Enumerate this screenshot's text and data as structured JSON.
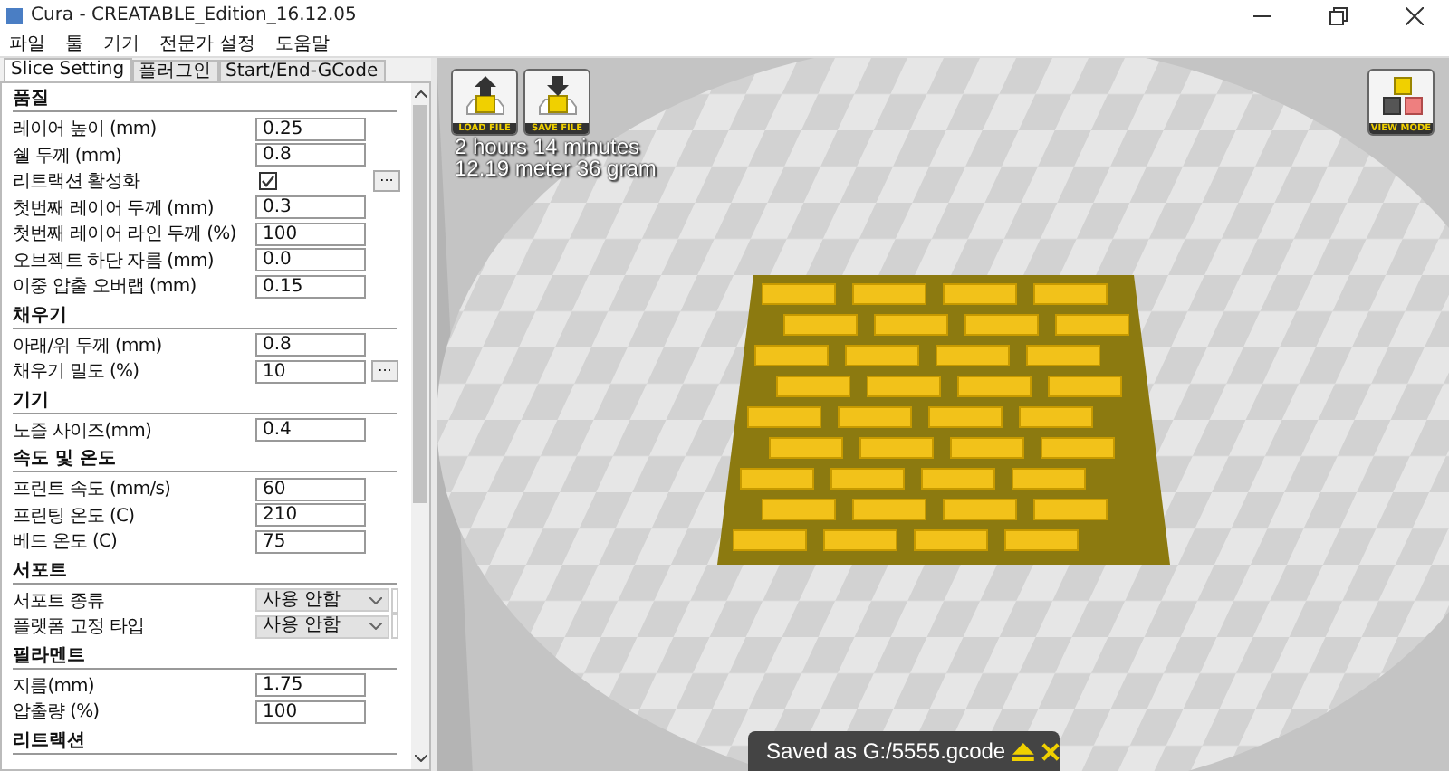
{
  "window": {
    "title": "Cura - CREATABLE_Edition_16.12.05"
  },
  "menu": [
    "파일",
    "툴",
    "기기",
    "전문가 설정",
    "도움말"
  ],
  "tabs": [
    {
      "label": "Slice Setting",
      "selected": true
    },
    {
      "label": "플러그인",
      "selected": false
    },
    {
      "label": "Start/End-GCode",
      "selected": false
    }
  ],
  "sections": [
    {
      "title": "품질",
      "rows": [
        {
          "kind": "text",
          "label": "레이어 높이 (mm)",
          "value": "0.25"
        },
        {
          "kind": "text",
          "label": "쉘 두께 (mm)",
          "value": "0.8"
        },
        {
          "kind": "checkbox",
          "label": "리트랙션 활성화",
          "checked": true,
          "more": "..."
        },
        {
          "kind": "text",
          "label": "첫번째 레이어 두께 (mm)",
          "value": "0.3"
        },
        {
          "kind": "text",
          "label": "첫번째 레이어 라인 두께 (%)",
          "value": "100"
        },
        {
          "kind": "text",
          "label": "오브젝트 하단 자름 (mm)",
          "value": "0.0"
        },
        {
          "kind": "text",
          "label": "이중 압출 오버랩 (mm)",
          "value": "0.15"
        }
      ]
    },
    {
      "title": "채우기",
      "rows": [
        {
          "kind": "text",
          "label": "아래/위 두께 (mm)",
          "value": "0.8"
        },
        {
          "kind": "text",
          "label": "채우기 밀도 (%)",
          "value": "10",
          "more": "..."
        }
      ]
    },
    {
      "title": "기기",
      "rows": [
        {
          "kind": "text",
          "label": "노즐 사이즈(mm)",
          "value": "0.4"
        }
      ]
    },
    {
      "title": "속도 및 온도",
      "rows": [
        {
          "kind": "text",
          "label": "프린트 속도 (mm/s)",
          "value": "60"
        },
        {
          "kind": "text",
          "label": "프린팅 온도 (C)",
          "value": "210"
        },
        {
          "kind": "text",
          "label": "베드 온도 (C)",
          "value": "75"
        }
      ]
    },
    {
      "title": "서포트",
      "rows": [
        {
          "kind": "select",
          "label": "서포트 종류",
          "value": "사용 안함"
        },
        {
          "kind": "select",
          "label": "플랫폼 고정 타입",
          "value": "사용 안함"
        }
      ]
    },
    {
      "title": "필라멘트",
      "rows": [
        {
          "kind": "text",
          "label": "지름(mm)",
          "value": "1.75"
        },
        {
          "kind": "text",
          "label": "압출량 (%)",
          "value": "100"
        }
      ]
    },
    {
      "title": "리트랙션"
    }
  ],
  "viewport": {
    "buttons": [
      {
        "kind": "load",
        "label": "LOAD FILE"
      },
      {
        "kind": "save",
        "label": "SAVE FILE"
      }
    ],
    "print_time": "2 hours 14 minutes",
    "print_amount": "12.19 meter 36 gram",
    "view_mode": "VIEW MODE",
    "notification": "Saved as G:/5555.gcode"
  }
}
